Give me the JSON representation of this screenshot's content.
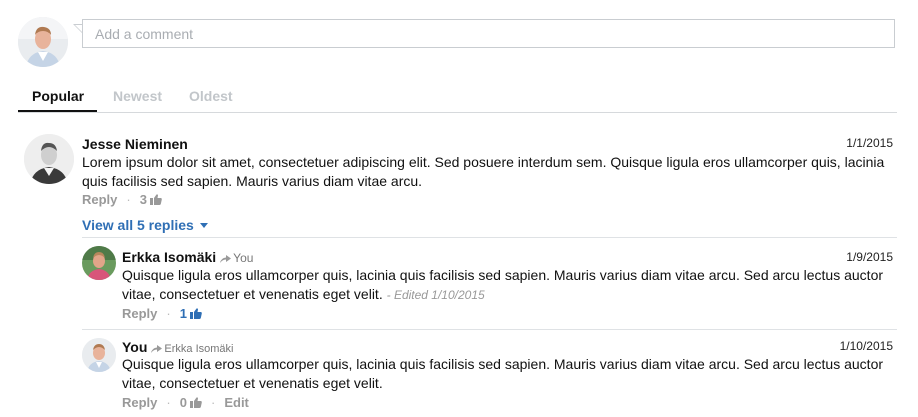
{
  "composer": {
    "placeholder": "Add a comment"
  },
  "tabs": [
    {
      "label": "Popular",
      "active": true
    },
    {
      "label": "Newest",
      "active": false
    },
    {
      "label": "Oldest",
      "active": false
    }
  ],
  "comments": [
    {
      "author": "Jesse Nieminen",
      "date": "1/1/2015",
      "text": "Lorem ipsum dolor sit amet, consectetuer adipiscing elit. Sed posuere interdum sem. Quisque ligula eros ullamcorper quis, lacinia quis facilisis sed sapien. Mauris varius diam vitae arcu.",
      "reply_label": "Reply",
      "likes": "3",
      "view_replies": "View all 5 replies"
    }
  ],
  "replies": [
    {
      "author": "Erkka Isomäki",
      "reply_to": "You",
      "date": "1/9/2015",
      "text": "Quisque ligula eros ullamcorper quis, lacinia quis facilisis sed sapien. Mauris varius diam vitae arcu. Sed arcu lectus auctor vitae, consectetuer et venenatis eget velit.",
      "edited": "- Edited 1/10/2015",
      "reply_label": "Reply",
      "likes": "1"
    },
    {
      "author": "You",
      "reply_to": "Erkka Isomäki",
      "date": "1/10/2015",
      "text": "Quisque ligula eros ullamcorper quis, lacinia quis facilisis sed sapien. Mauris varius diam vitae arcu. Sed arcu lectus auctor vitae, consectetuer et venenatis eget velit.",
      "reply_label": "Reply",
      "likes": "0",
      "edit_label": "Edit"
    }
  ],
  "colors": {
    "link_blue": "#2f6fb5",
    "muted_text": "#999999",
    "border": "#c9cdd1"
  },
  "icons": {
    "like": "thumbs-up-icon",
    "reply_to": "share-arrow-icon",
    "expand": "caret-down-icon"
  }
}
